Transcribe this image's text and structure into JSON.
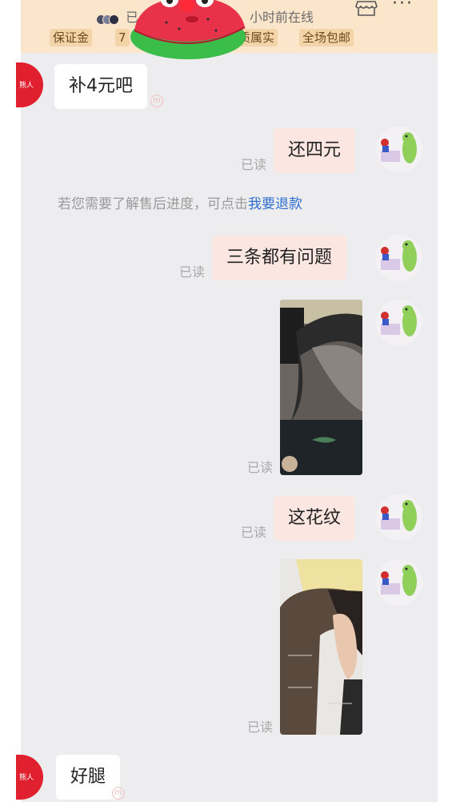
{
  "header": {
    "status_prefix": "已",
    "status_suffix": "小时前在线",
    "more_glyph": "···",
    "tags": [
      "保证金",
      "7",
      "质属实",
      "全场包邮"
    ]
  },
  "messages": [
    {
      "side": "left",
      "text": "补4元吧"
    },
    {
      "side": "right",
      "text": "还四元",
      "read": "已读"
    },
    {
      "side": "system",
      "text": "若您需要了解售后进度，可点击",
      "link": "我要退款"
    },
    {
      "side": "right",
      "text": "三条都有问题",
      "read": "已读"
    },
    {
      "side": "right",
      "type": "image",
      "read": "已读"
    },
    {
      "side": "right",
      "text": "这花纹",
      "read": "已读"
    },
    {
      "side": "right",
      "type": "image",
      "read": "已读"
    },
    {
      "side": "left",
      "text": "好腿"
    }
  ],
  "avatar_left_label": "熊人",
  "watermark_glyph": "m",
  "colors": {
    "header_bg": "#fbe6cb",
    "tag_bg": "#f3d4a8",
    "chat_bg": "#ededef",
    "bubble_right": "#fbe6e1",
    "bubble_left": "#ffffff",
    "link": "#2f6fd0",
    "avatar_left": "#e0202f"
  }
}
